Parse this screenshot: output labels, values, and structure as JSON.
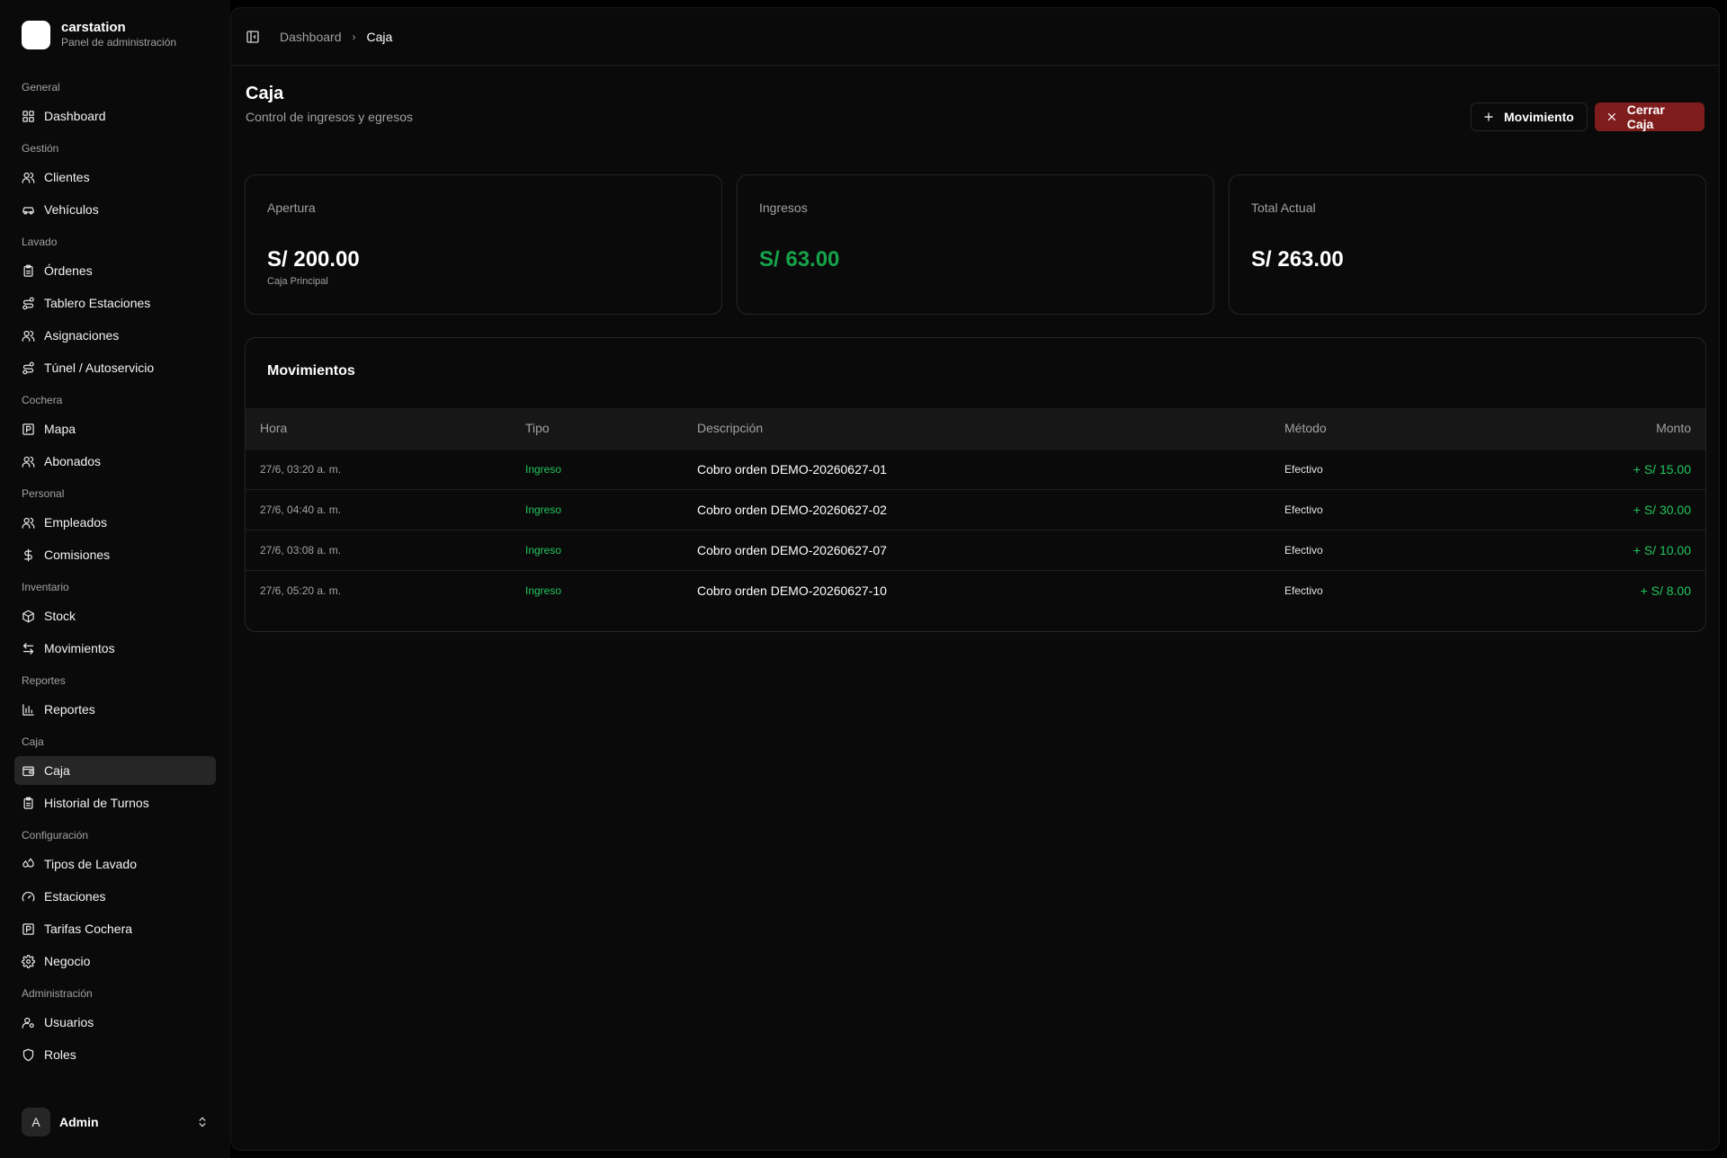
{
  "brand": {
    "name": "carstation",
    "subtitle": "Panel de administración"
  },
  "sidebar": {
    "groups": [
      {
        "label": "General",
        "items": [
          {
            "label": "Dashboard",
            "icon": "dashboard-icon"
          }
        ]
      },
      {
        "label": "Gestión",
        "items": [
          {
            "label": "Clientes",
            "icon": "users-icon"
          },
          {
            "label": "Vehículos",
            "icon": "car-icon"
          }
        ]
      },
      {
        "label": "Lavado",
        "items": [
          {
            "label": "Órdenes",
            "icon": "clipboard-icon"
          },
          {
            "label": "Tablero Estaciones",
            "icon": "route-icon"
          },
          {
            "label": "Asignaciones",
            "icon": "users-icon"
          },
          {
            "label": "Túnel / Autoservicio",
            "icon": "route-icon"
          }
        ]
      },
      {
        "label": "Cochera",
        "items": [
          {
            "label": "Mapa",
            "icon": "parking-icon"
          },
          {
            "label": "Abonados",
            "icon": "users-icon"
          }
        ]
      },
      {
        "label": "Personal",
        "items": [
          {
            "label": "Empleados",
            "icon": "users-icon"
          },
          {
            "label": "Comisiones",
            "icon": "dollar-icon"
          }
        ]
      },
      {
        "label": "Inventario",
        "items": [
          {
            "label": "Stock",
            "icon": "package-icon"
          },
          {
            "label": "Movimientos",
            "icon": "arrows-icon"
          }
        ]
      },
      {
        "label": "Reportes",
        "items": [
          {
            "label": "Reportes",
            "icon": "chart-icon"
          }
        ]
      },
      {
        "label": "Caja",
        "items": [
          {
            "label": "Caja",
            "icon": "wallet-icon",
            "active": true
          },
          {
            "label": "Historial de Turnos",
            "icon": "clipboard-icon"
          }
        ]
      },
      {
        "label": "Configuración",
        "items": [
          {
            "label": "Tipos de Lavado",
            "icon": "droplets-icon"
          },
          {
            "label": "Estaciones",
            "icon": "gauge-icon"
          },
          {
            "label": "Tarifas Cochera",
            "icon": "parking-icon"
          },
          {
            "label": "Negocio",
            "icon": "gear-icon"
          }
        ]
      },
      {
        "label": "Administración",
        "items": [
          {
            "label": "Usuarios",
            "icon": "user-cog-icon"
          },
          {
            "label": "Roles",
            "icon": "shield-icon"
          }
        ]
      }
    ]
  },
  "user": {
    "initial": "A",
    "name": "Admin"
  },
  "breadcrumb": {
    "parent": "Dashboard",
    "current": "Caja"
  },
  "page": {
    "title": "Caja",
    "subtitle": "Control de ingresos y egresos"
  },
  "actions": {
    "movement": "Movimiento",
    "close": "Cerrar Caja"
  },
  "cards": [
    {
      "label": "Apertura",
      "value": "S/ 200.00",
      "note": "Caja Principal"
    },
    {
      "label": "Ingresos",
      "value": "S/ 63.00",
      "note": ""
    },
    {
      "label": "Total Actual",
      "value": "S/ 263.00",
      "note": ""
    }
  ],
  "movements": {
    "title": "Movimientos",
    "columns": [
      "Hora",
      "Tipo",
      "Descripción",
      "Método",
      "Monto"
    ],
    "rows": [
      [
        "27/6, 03:20 a. m.",
        "Ingreso",
        "Cobro orden DEMO-20260627-01",
        "Efectivo",
        "+ S/ 15.00"
      ],
      [
        "27/6, 04:40 a. m.",
        "Ingreso",
        "Cobro orden DEMO-20260627-02",
        "Efectivo",
        "+ S/ 30.00"
      ],
      [
        "27/6, 03:08 a. m.",
        "Ingreso",
        "Cobro orden DEMO-20260627-07",
        "Efectivo",
        "+ S/ 10.00"
      ],
      [
        "27/6, 05:20 a. m.",
        "Ingreso",
        "Cobro orden DEMO-20260627-10",
        "Efectivo",
        "+ S/ 8.00"
      ]
    ]
  },
  "colors": {
    "accent_green": "#22c55e",
    "danger": "#7f1d1d",
    "background": "#0a0a0a"
  }
}
